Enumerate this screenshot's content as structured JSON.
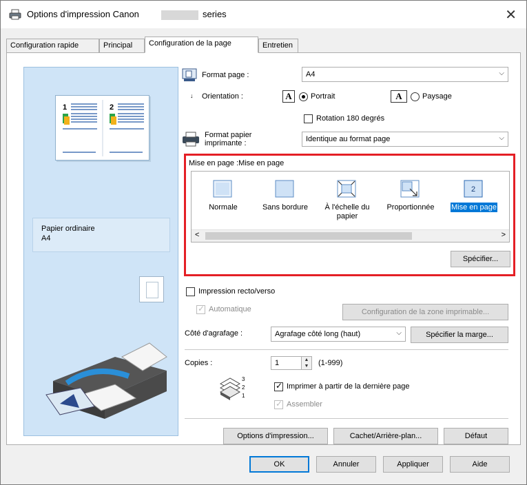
{
  "window": {
    "title_prefix": "Options d'impression Canon",
    "title_suffix": "series",
    "close_glyph": "✕"
  },
  "tabs": [
    {
      "label": "Configuration rapide",
      "active": false
    },
    {
      "label": "Principal",
      "active": false
    },
    {
      "label": "Configuration de la page",
      "active": true
    },
    {
      "label": "Entretien",
      "active": false
    }
  ],
  "preview": {
    "paper_type": "Papier ordinaire",
    "paper_size": "A4"
  },
  "page_setup": {
    "format_page_label": "Format page :",
    "format_page_value": "A4",
    "orientation_label": "Orientation :",
    "portrait_label": "Portrait",
    "landscape_label": "Paysage",
    "orientation_glyph": "A",
    "rotation_label": "Rotation 180 degrés",
    "paper_printer_label_1": "Format papier",
    "paper_printer_label_2": "imprimante :",
    "paper_printer_value": "Identique au format page"
  },
  "layout": {
    "group_label": "Mise en page :Mise en page",
    "items": [
      {
        "label_1": "Normale",
        "label_2": "",
        "selected": false
      },
      {
        "label_1": "Sans bordure",
        "label_2": "",
        "selected": false
      },
      {
        "label_1": "À l'échelle du",
        "label_2": "papier",
        "selected": false
      },
      {
        "label_1": "Proportionnée",
        "label_2": "",
        "selected": false
      },
      {
        "label_1": "Mise en page",
        "label_2": "",
        "selected": true
      }
    ],
    "selected_icon_number": "2",
    "scroll_left": "<",
    "scroll_right": ">",
    "specify_button": "Spécifier..."
  },
  "duplex": {
    "duplex_label": "Impression recto/verso",
    "auto_label": "Automatique",
    "printable_area_button": "Configuration de la zone imprimable...",
    "stapling_label": "Côté d'agrafage :",
    "stapling_value": "Agrafage côté long (haut)",
    "margin_button": "Spécifier la marge..."
  },
  "copies": {
    "label": "Copies :",
    "value": "1",
    "range": "(1-999)",
    "last_page_label": "Imprimer à partir de la dernière page",
    "collate_label": "Assembler"
  },
  "page_buttons": {
    "print_options": "Options d'impression...",
    "stamp_background": "Cachet/Arrière-plan...",
    "defaults": "Défaut"
  },
  "dialog_buttons": {
    "ok": "OK",
    "cancel": "Annuler",
    "apply": "Appliquer",
    "help": "Aide"
  },
  "colors": {
    "highlight_border": "#e41f25",
    "selection": "#0078d7",
    "preview_bg": "#cfe4f7"
  }
}
